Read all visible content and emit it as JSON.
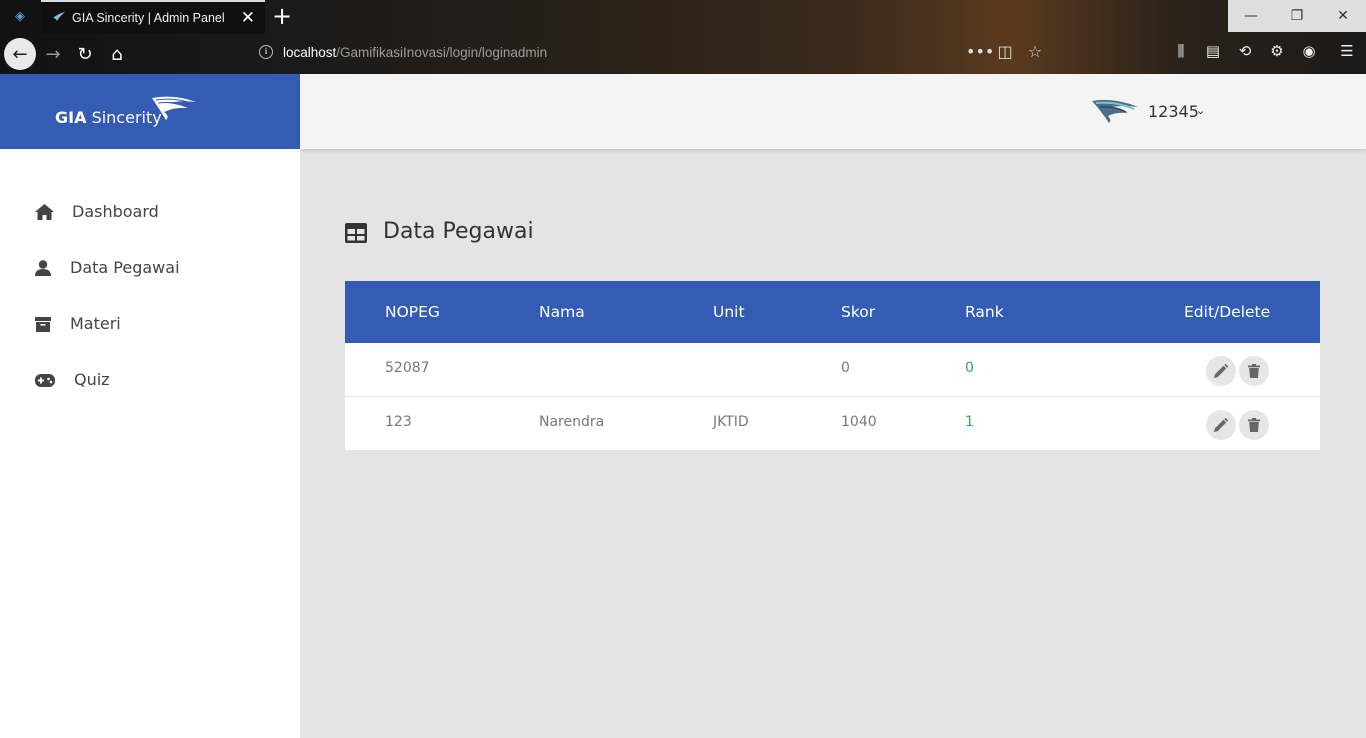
{
  "browser": {
    "tab_title": "GIA Sincerity | Admin Panel",
    "url_host": "localhost",
    "url_path": "/GamifikasiInovasi/login/loginadmin"
  },
  "brand": {
    "name_bold": "GIA",
    "name_rest": "Sincerity"
  },
  "user": {
    "name": "12345"
  },
  "sidebar": {
    "items": [
      {
        "label": "Dashboard",
        "icon": "home-icon"
      },
      {
        "label": "Data Pegawai",
        "icon": "user-icon"
      },
      {
        "label": "Materi",
        "icon": "archive-icon"
      },
      {
        "label": "Quiz",
        "icon": "gamepad-icon"
      }
    ]
  },
  "page": {
    "title": "Data Pegawai"
  },
  "table": {
    "headers": [
      "NOPEG",
      "Nama",
      "Unit",
      "Skor",
      "Rank",
      "Edit/Delete"
    ],
    "rows": [
      {
        "nopeg": "52087",
        "nama": "",
        "unit": "",
        "skor": "0",
        "rank": "0"
      },
      {
        "nopeg": "123",
        "nama": "Narendra",
        "unit": "JKTID",
        "skor": "1040",
        "rank": "1"
      }
    ]
  },
  "colors": {
    "primary": "#355cb5",
    "rank": "#2ea84a"
  }
}
